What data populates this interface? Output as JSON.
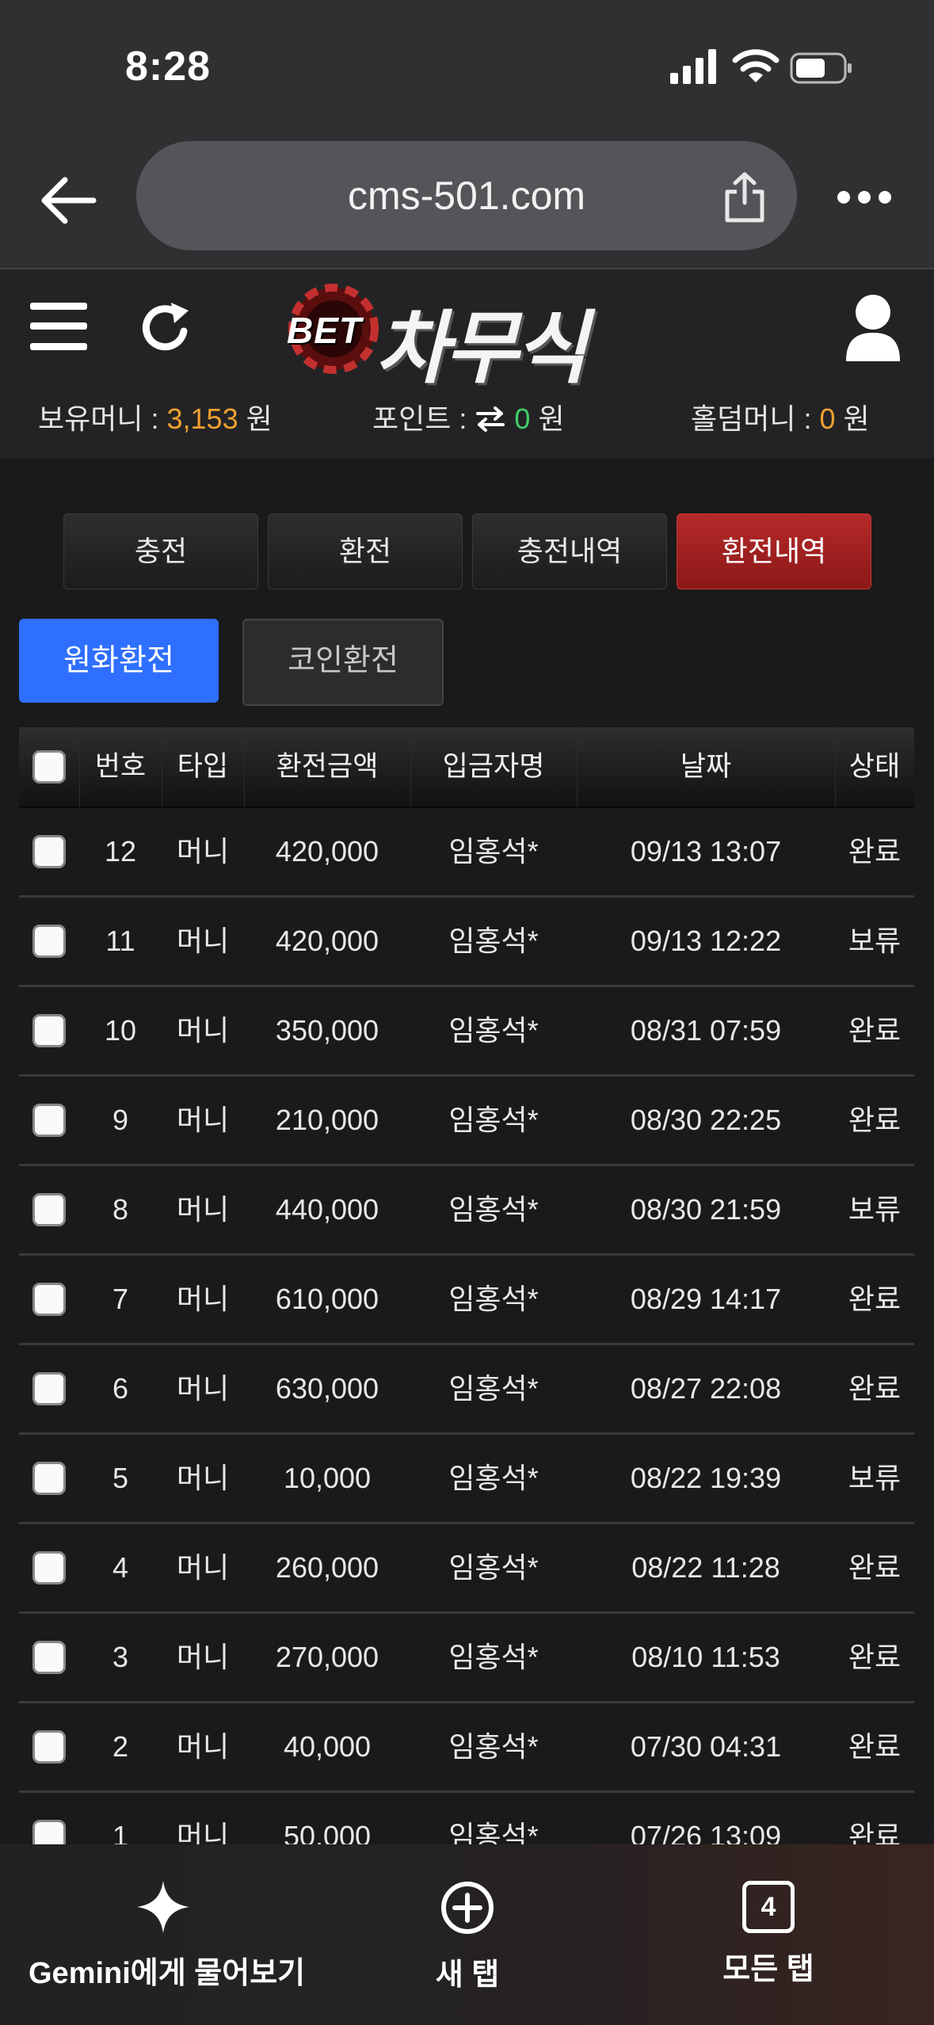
{
  "status_bar": {
    "time": "8:28"
  },
  "browser": {
    "url": "cms-501.com"
  },
  "header": {
    "logo_badge": "BET",
    "logo_text": "차무식",
    "balance": {
      "label": "보유머니 :",
      "value": "3,153",
      "unit": "원"
    },
    "points": {
      "label": "포인트 :",
      "value": "0",
      "unit": "원"
    },
    "holdem": {
      "label": "홀덤머니 :",
      "value": "0",
      "unit": "원"
    }
  },
  "tabs": [
    "충전",
    "환전",
    "충전내역",
    "환전내역"
  ],
  "active_tab": "환전내역",
  "subtabs": [
    "원화환전",
    "코인환전"
  ],
  "table": {
    "columns": [
      "번호",
      "타입",
      "환전금액",
      "입금자명",
      "날짜",
      "상태"
    ],
    "rows": [
      {
        "no": "12",
        "type": "머니",
        "amount": "420,000",
        "name": "임홍석*",
        "date": "09/13 13:07",
        "status": "완료"
      },
      {
        "no": "11",
        "type": "머니",
        "amount": "420,000",
        "name": "임홍석*",
        "date": "09/13 12:22",
        "status": "보류"
      },
      {
        "no": "10",
        "type": "머니",
        "amount": "350,000",
        "name": "임홍석*",
        "date": "08/31 07:59",
        "status": "완료"
      },
      {
        "no": "9",
        "type": "머니",
        "amount": "210,000",
        "name": "임홍석*",
        "date": "08/30 22:25",
        "status": "완료"
      },
      {
        "no": "8",
        "type": "머니",
        "amount": "440,000",
        "name": "임홍석*",
        "date": "08/30 21:59",
        "status": "보류"
      },
      {
        "no": "7",
        "type": "머니",
        "amount": "610,000",
        "name": "임홍석*",
        "date": "08/29 14:17",
        "status": "완료"
      },
      {
        "no": "6",
        "type": "머니",
        "amount": "630,000",
        "name": "임홍석*",
        "date": "08/27 22:08",
        "status": "완료"
      },
      {
        "no": "5",
        "type": "머니",
        "amount": "10,000",
        "name": "임홍석*",
        "date": "08/22 19:39",
        "status": "보류"
      },
      {
        "no": "4",
        "type": "머니",
        "amount": "260,000",
        "name": "임홍석*",
        "date": "08/22 11:28",
        "status": "완료"
      },
      {
        "no": "3",
        "type": "머니",
        "amount": "270,000",
        "name": "임홍석*",
        "date": "08/10 11:53",
        "status": "완료"
      },
      {
        "no": "2",
        "type": "머니",
        "amount": "40,000",
        "name": "임홍석*",
        "date": "07/30 04:31",
        "status": "완료"
      },
      {
        "no": "1",
        "type": "머니",
        "amount": "50,000",
        "name": "임홍석*",
        "date": "07/26 13:09",
        "status": "완료"
      }
    ]
  },
  "bottom_bar": {
    "gemini": "Gemini에게 물어보기",
    "new_tab": "새 탭",
    "all_tabs": "모든 탭",
    "tab_count": "4"
  },
  "colors": {
    "accent_blue": "#2f6fff",
    "active_red": "#9e2020",
    "money_orange": "#f0a030",
    "points_green": "#3fd06a"
  }
}
